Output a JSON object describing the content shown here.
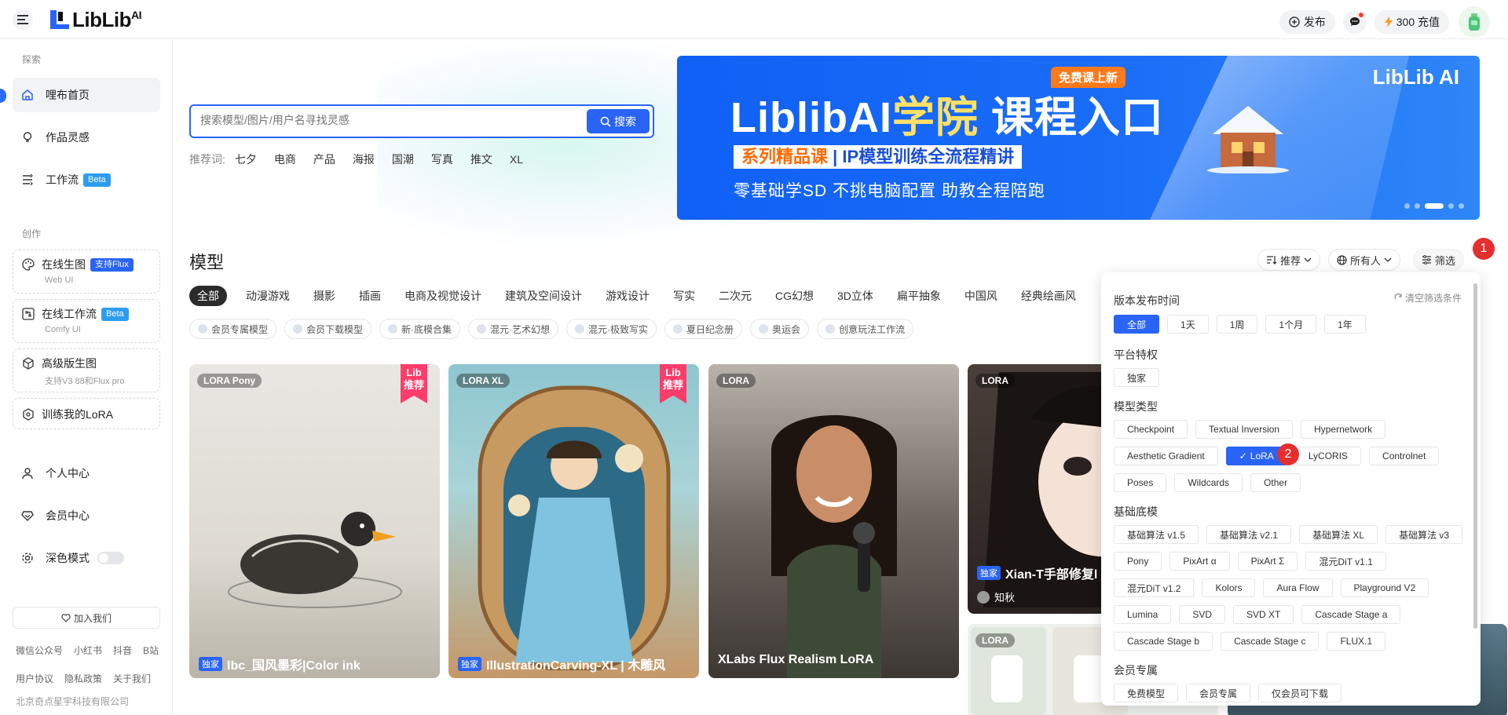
{
  "topbar": {
    "logo_text": "LibLib",
    "logo_sup": "AI",
    "publish_label": "发布",
    "points_label": "300 充值"
  },
  "sidebar": {
    "explore_label": "探索",
    "create_label": "创作",
    "items": [
      {
        "label": "哩布首页"
      },
      {
        "label": "作品灵感"
      },
      {
        "label": "工作流",
        "badge": "Beta"
      }
    ],
    "create_cards": [
      {
        "label": "在线生图",
        "badge": "支持Flux",
        "sub": "Web UI"
      },
      {
        "label": "在线工作流",
        "badge": "Beta",
        "sub": "Comfy UI"
      },
      {
        "label": "高级版生图",
        "sub": "支持V3 88和Flux pro"
      },
      {
        "label": "训练我的LoRA"
      }
    ],
    "personal": "个人中心",
    "member": "会员中心",
    "dark_mode": "深色模式",
    "join": "加入我们",
    "links1": [
      "微信公众号",
      "小红书",
      "抖音",
      "B站"
    ],
    "links2": [
      "用户协议",
      "隐私政策",
      "关于我们"
    ],
    "company": "北京奇点星宇科技有限公司"
  },
  "search": {
    "placeholder": "搜索模型/图片/用户名寻找灵感",
    "button": "搜索",
    "rec_label": "推荐词:",
    "rec_tags": [
      "七夕",
      "电商",
      "产品",
      "海报",
      "国潮",
      "写真",
      "推文",
      "XL"
    ]
  },
  "banner": {
    "title_a": "LiblibAI",
    "title_b": "学院",
    "title_c": " 课程入口",
    "tag": "免费课上新",
    "sub_a": "系列精品课",
    "sub_b": "IP模型训练全流程精讲",
    "line": "零基础学SD  不挑电脑配置  助教全程陪跑",
    "logo": "LibLib AI"
  },
  "models": {
    "title": "模型",
    "sort_label": "推荐",
    "scope_label": "所有人",
    "filter_label": "筛选",
    "marker1": "1",
    "marker2": "2",
    "categories": [
      "全部",
      "动漫游戏",
      "摄影",
      "插画",
      "电商及视觉设计",
      "建筑及空间设计",
      "游戏设计",
      "写实",
      "二次元",
      "CG幻想",
      "3D立体",
      "扁平抽象",
      "中国风",
      "经典绘画风"
    ],
    "chips": [
      "会员专属模型",
      "会员下载模型",
      "新·底模合集",
      "混元·艺术幻想",
      "混元·极致写实",
      "夏日纪念册",
      "奥运会",
      "创意玩法工作流"
    ],
    "cards": [
      {
        "tag": "LORA  Pony",
        "ribbon": "Lib 推荐",
        "exclusive": "独家",
        "name": "lbc_国风墨彩|Color ink"
      },
      {
        "tag": "LORA  XL",
        "ribbon": "Lib 推荐",
        "exclusive": "独家",
        "name": "IllustrationCarving-XL | 木雕风"
      },
      {
        "tag": "LORA",
        "name": "XLabs Flux Realism LoRA"
      },
      {
        "tag": "LORA",
        "exclusive": "独家",
        "name": "Xian-T手部修复l",
        "author": "知秋"
      },
      {
        "tag": "LORA"
      }
    ]
  },
  "filter": {
    "clear": "清空筛选条件",
    "release_label": "版本发布时间",
    "release": [
      "全部",
      "1天",
      "1周",
      "1个月",
      "1年"
    ],
    "privilege_label": "平台特权",
    "privilege": [
      "独家"
    ],
    "type_label": "模型类型",
    "type_row1": [
      "Checkpoint",
      "Textual Inversion",
      "Hypernetwork"
    ],
    "type_row2": [
      "Aesthetic Gradient",
      "LoRA",
      "LyCORIS",
      "Controlnet"
    ],
    "type_row3": [
      "Poses",
      "Wildcards",
      "Other"
    ],
    "base_label": "基础底模",
    "base_row1": [
      "基础算法 v1.5",
      "基础算法 v2.1",
      "基础算法 XL",
      "基础算法 v3"
    ],
    "base_row2": [
      "Pony",
      "PixArt α",
      "PixArt Σ",
      "混元DiT v1.1"
    ],
    "base_row3": [
      "混元DiT v1.2",
      "Kolors",
      "Aura Flow",
      "Playground V2"
    ],
    "base_row4": [
      "Lumina",
      "SVD",
      "SVD XT",
      "Cascade Stage a"
    ],
    "base_row5": [
      "Cascade Stage b",
      "Cascade Stage c",
      "FLUX.1"
    ],
    "member_label": "会员专属",
    "member": [
      "免费模型",
      "会员专属",
      "仅会员可下载"
    ]
  }
}
